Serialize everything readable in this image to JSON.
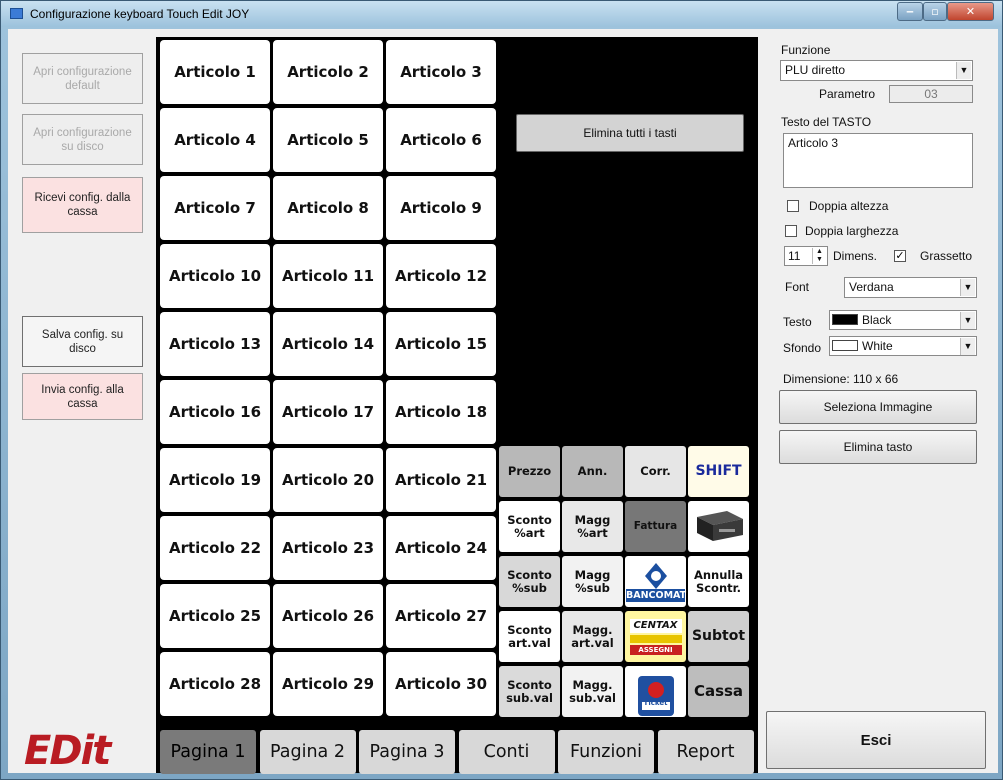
{
  "window": {
    "title": "Configurazione keyboard Touch Edit JOY",
    "min": "‒",
    "max": "▫",
    "close": "✕"
  },
  "left": {
    "open_default": "Apri configurazione default",
    "open_disk": "Apri configurazione su disco",
    "receive": "Ricevi  config. dalla cassa",
    "save_disk": "Salva  config. su disco",
    "send": "Invia config. alla cassa",
    "logo": "EDit"
  },
  "articles": [
    "Articolo 1",
    "Articolo 2",
    "Articolo 3",
    "Articolo 4",
    "Articolo 5",
    "Articolo 6",
    "Articolo 7",
    "Articolo 8",
    "Articolo 9",
    "Articolo 10",
    "Articolo 11",
    "Articolo 12",
    "Articolo 13",
    "Articolo 14",
    "Articolo 15",
    "Articolo 16",
    "Articolo 17",
    "Articolo 18",
    "Articolo 19",
    "Articolo 20",
    "Articolo 21",
    "Articolo 22",
    "Articolo 23",
    "Articolo 24",
    "Articolo 25",
    "Articolo 26",
    "Articolo 27",
    "Articolo 28",
    "Articolo 29",
    "Articolo 30"
  ],
  "delete_all": "Elimina tutti i tasti",
  "func_keys": {
    "prezzo": "Prezzo",
    "ann": "Ann.",
    "corr": "Corr.",
    "shift": "SHIFT",
    "sconto_art": "Sconto %art",
    "magg_art": "Magg %art",
    "fattura": "Fattura",
    "sconto_sub": "Sconto %sub",
    "magg_sub": "Magg %sub",
    "bancomat": "BANCOMAT",
    "annulla": "Annulla Scontr.",
    "sconto_artval": "Sconto art.val",
    "magg_artval": "Magg. art.val",
    "centax": "CENTAX",
    "assegni": "ASSEGNI",
    "subtot": "Subtot",
    "sconto_subval": "Sconto sub.val",
    "magg_subval": "Magg. sub.val",
    "ticket": "Ticket",
    "cassa": "Cassa"
  },
  "tabs": [
    "Pagina 1",
    "Pagina 2",
    "Pagina 3",
    "Conti",
    "Funzioni",
    "Report"
  ],
  "props": {
    "funzione_label": "Funzione",
    "funzione_value": "PLU diretto",
    "parametro_label": "Parametro",
    "parametro_value": "03",
    "testo_label": "Testo del TASTO",
    "testo_value": "Articolo 3",
    "doppia_altezza": "Doppia altezza",
    "doppia_larghezza": "Doppia larghezza",
    "dimens_value": "11",
    "dimens_label": "Dimens.",
    "grassetto": "Grassetto",
    "font_label": "Font",
    "font_value": "Verdana",
    "testo_color_label": "Testo",
    "testo_color_value": "Black",
    "sfondo_label": "Sfondo",
    "sfondo_value": "White",
    "dimensione": "Dimensione: 110 x 66",
    "seleziona": "Seleziona Immagine",
    "elimina": "Elimina tasto",
    "esci": "Esci"
  },
  "colors": {
    "text_swatch": "#000000",
    "bg_swatch": "#ffffff",
    "brand": "#b91c23",
    "shift": "#1a2a9c"
  }
}
